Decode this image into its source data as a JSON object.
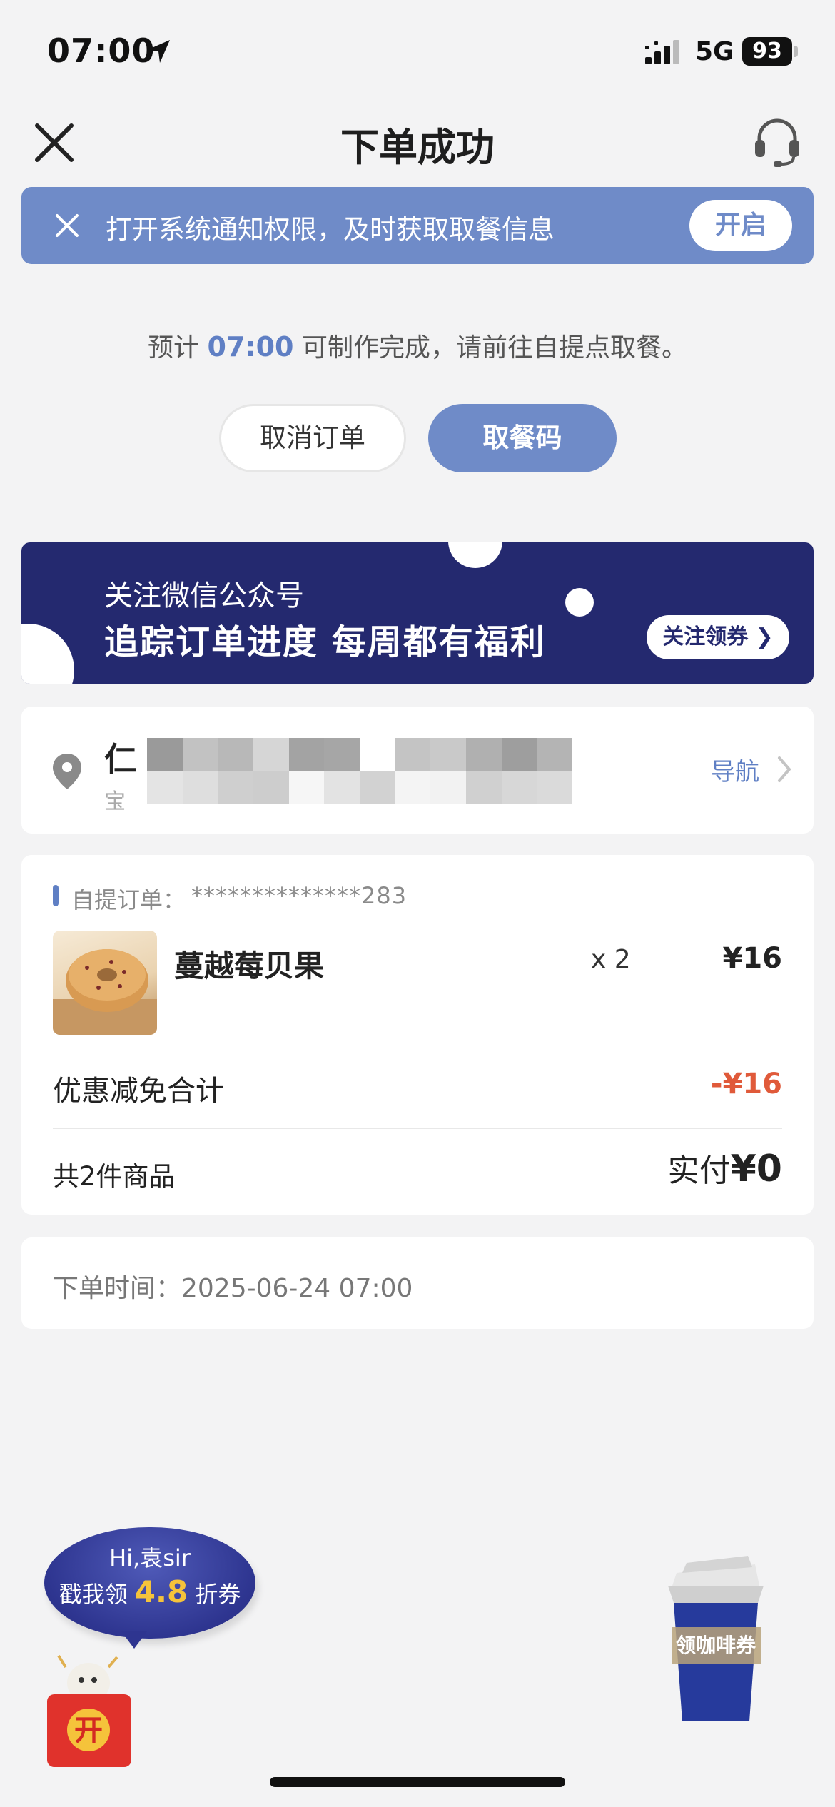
{
  "status_bar": {
    "time": "07:00",
    "network": "5G",
    "battery": "93"
  },
  "header": {
    "title": "下单成功"
  },
  "notice": {
    "text": "打开系统通知权限，及时获取取餐信息",
    "button": "开启"
  },
  "estimate": {
    "prefix": "预计",
    "time": "07:00",
    "suffix": "可制作完成，请前往自提点取餐。"
  },
  "actions": {
    "cancel": "取消订单",
    "pickup_code": "取餐码"
  },
  "promo": {
    "line1": "关注微信公众号",
    "line2": "追踪订单进度 每周都有福利",
    "button": "关注领券"
  },
  "store": {
    "name_visible": "仁",
    "sub_visible": "宝",
    "nav": "导航"
  },
  "order": {
    "label": "自提订单：",
    "number": "**************283",
    "item": {
      "name": "蔓越莓贝果",
      "qty": "x 2",
      "price": "¥16"
    },
    "discount_label": "优惠减免合计",
    "discount_value": "-¥16",
    "count_text": "共2件商品",
    "paid_label": "实付",
    "paid_amount": "¥0"
  },
  "order_time": {
    "text": "下单时间：2025-06-24 07:00"
  },
  "floating": {
    "greeting": "Hi,袁sir",
    "coupon_prefix": "戳我领",
    "coupon_value": "4.8",
    "coupon_suffix": "折券",
    "redpack_char": "开",
    "coffee_coupon": "领咖啡券"
  },
  "colors": {
    "accent": "#6f8bc8",
    "promo_bg": "#24296f",
    "discount": "#e05a3a"
  }
}
